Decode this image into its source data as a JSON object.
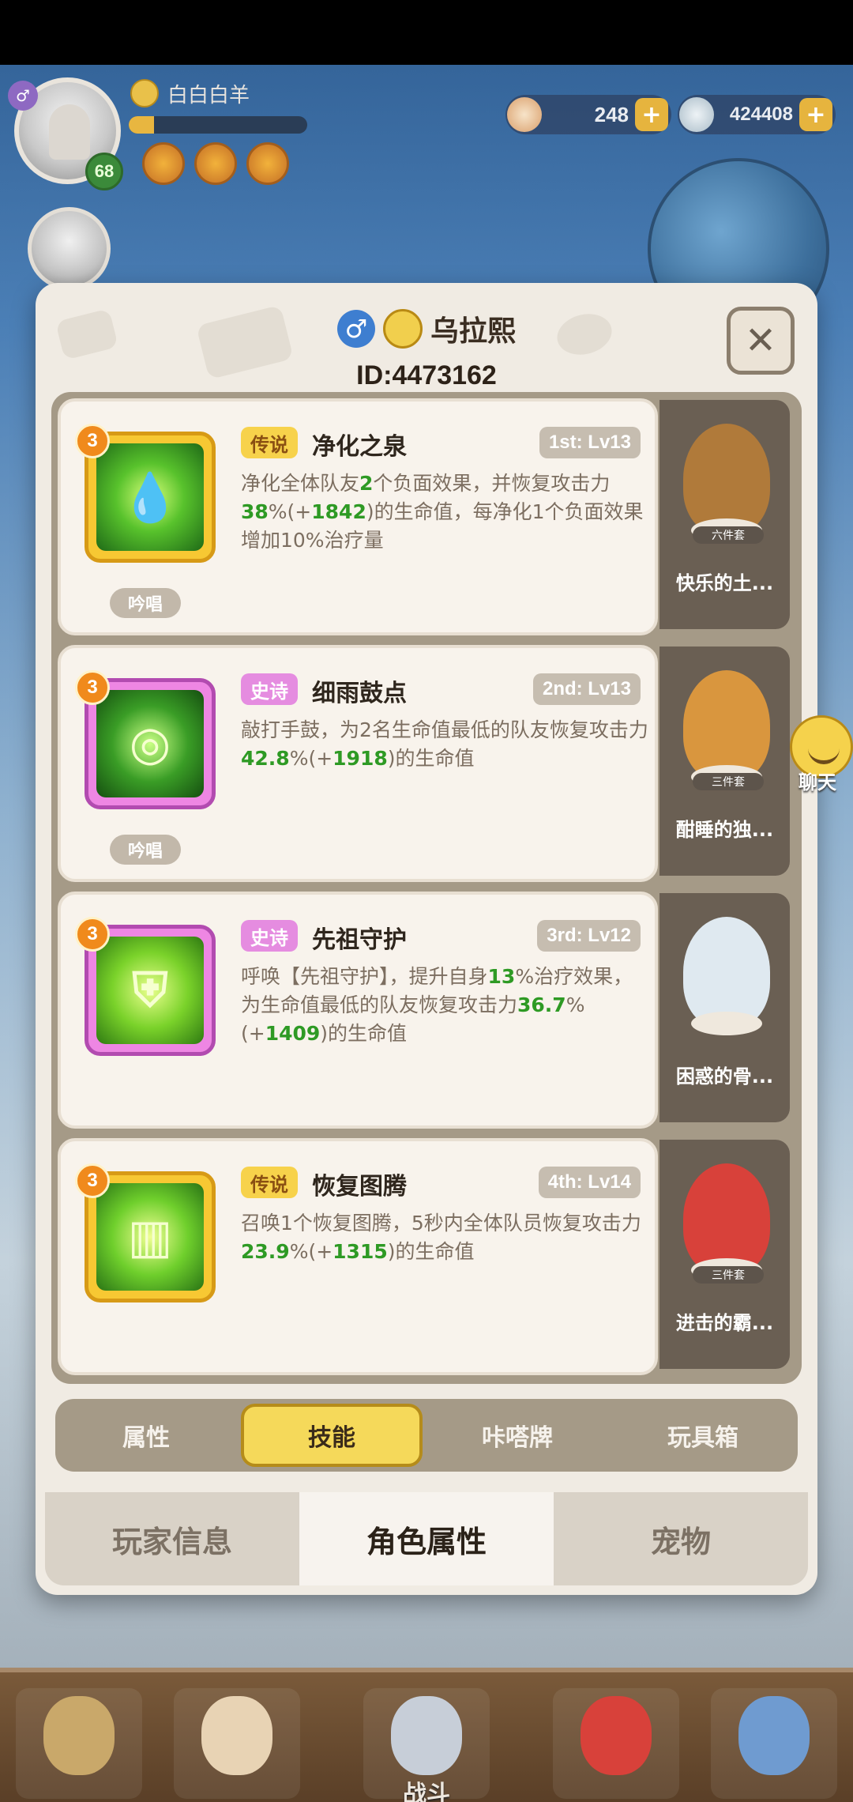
{
  "hud": {
    "player_name": "白白白羊",
    "level": "68",
    "gender_symbol": "♂",
    "exp_fraction": 0.14,
    "currency_1": "248",
    "currency_2": "424408",
    "plus": "+"
  },
  "modal": {
    "gender_symbol": "♂",
    "character_name": "乌拉熙",
    "character_id": "ID:4473162",
    "close_symbol": "✕"
  },
  "skills": [
    {
      "rank": "3",
      "rarity": "传说",
      "rarity_type": "legend",
      "name": "净化之泉",
      "level": "1st: Lv13",
      "tag": "吟唱",
      "icon": "water-drop-icon",
      "desc_parts": [
        "净化全体队友",
        "2",
        "个负面效果，并恢复攻击力",
        "38",
        "%(+",
        "1842",
        ")的生命值，每净化1个负面效果增加10%治疗量"
      ]
    },
    {
      "rank": "3",
      "rarity": "史诗",
      "rarity_type": "epic",
      "name": "细雨鼓点",
      "level": "2nd: Lv13",
      "tag": "吟唱",
      "icon": "drum-icon",
      "desc_parts": [
        "敲打手鼓，为2名生命值最低的队友恢复攻击力",
        "42.8",
        "%(+",
        "1918",
        ")的生命值"
      ]
    },
    {
      "rank": "3",
      "rarity": "史诗",
      "rarity_type": "epic",
      "name": "先祖守护",
      "level": "3rd: Lv12",
      "tag": "",
      "icon": "totem-shield-icon",
      "desc_parts": [
        "呼唤【先祖守护】，提升自身",
        "13",
        "%治疗效果，为生命值最低的队友恢复攻击力",
        "36.7",
        "%(+",
        "1409",
        ")的生命值"
      ]
    },
    {
      "rank": "3",
      "rarity": "传说",
      "rarity_type": "legend",
      "name": "恢复图腾",
      "level": "4th: Lv14",
      "tag": "",
      "icon": "totem-pole-icon",
      "desc_parts": [
        "召唤1个恢复图腾，5秒内全体队员恢复攻击力",
        "23.9",
        "%(+",
        "1315",
        ")的生命值"
      ]
    }
  ],
  "pets": [
    {
      "name": "快乐的土...",
      "set": "六件套",
      "color": "#b07a3a"
    },
    {
      "name": "酣睡的独...",
      "set": "三件套",
      "color": "#d9963e"
    },
    {
      "name": "困惑的骨...",
      "set": "",
      "color": "#dfe9f0"
    },
    {
      "name": "进击的霸...",
      "set": "三件套",
      "color": "#d8413a"
    }
  ],
  "sub_tabs": [
    "属性",
    "技能",
    "咔嗒牌",
    "玩具箱"
  ],
  "sub_tab_active": 1,
  "main_tabs": [
    "玩家信息",
    "角色属性",
    "宠物"
  ],
  "main_tab_active": 1,
  "chat_label": "聊天",
  "bottom_nav": {
    "battle_label": "战斗"
  },
  "colors": {
    "highlight_green": "#2e9a24",
    "legend_tag": "#f7d24b",
    "epic_tag": "#e58ce0",
    "active_tab": "#f5d95a"
  }
}
